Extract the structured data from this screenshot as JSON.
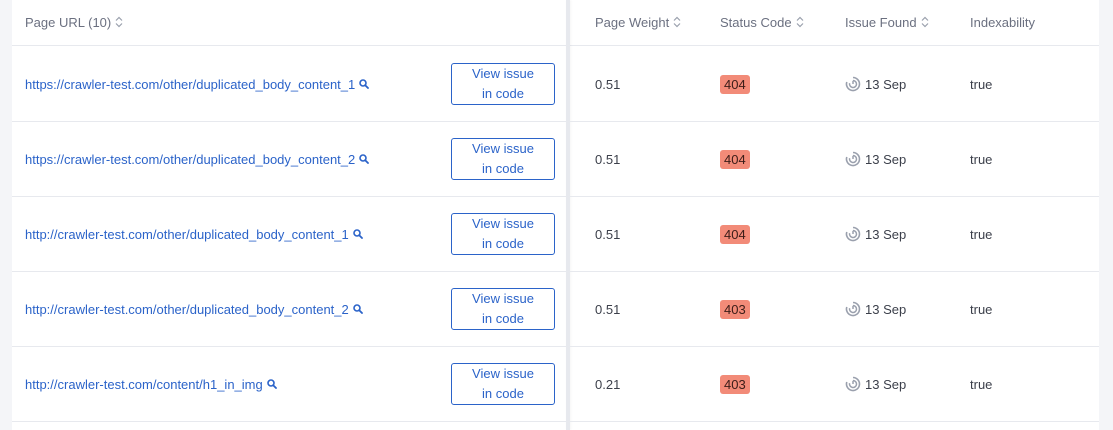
{
  "colors": {
    "link": "#2b63c9",
    "status_bad": "#f28b78",
    "divider": "#e7e9ee"
  },
  "header": {
    "page_url": "Page URL (10)",
    "page_weight": "Page Weight",
    "status_code": "Status Code",
    "issue_found": "Issue Found",
    "indexability": "Indexability"
  },
  "button": {
    "line1": "View issue",
    "line2": "in code"
  },
  "rows": [
    {
      "url": "https://crawler-test.com/other/duplicated_body_content_1",
      "weight": "0.51",
      "status": "404",
      "issue": "13 Sep",
      "index": "true"
    },
    {
      "url": "https://crawler-test.com/other/duplicated_body_content_2",
      "weight": "0.51",
      "status": "404",
      "issue": "13 Sep",
      "index": "true"
    },
    {
      "url": "http://crawler-test.com/other/duplicated_body_content_1",
      "weight": "0.51",
      "status": "404",
      "issue": "13 Sep",
      "index": "true"
    },
    {
      "url": "http://crawler-test.com/other/duplicated_body_content_2",
      "weight": "0.51",
      "status": "403",
      "issue": "13 Sep",
      "index": "true"
    },
    {
      "url": "http://crawler-test.com/content/h1_in_img",
      "weight": "0.21",
      "status": "403",
      "issue": "13 Sep",
      "index": "true"
    }
  ]
}
